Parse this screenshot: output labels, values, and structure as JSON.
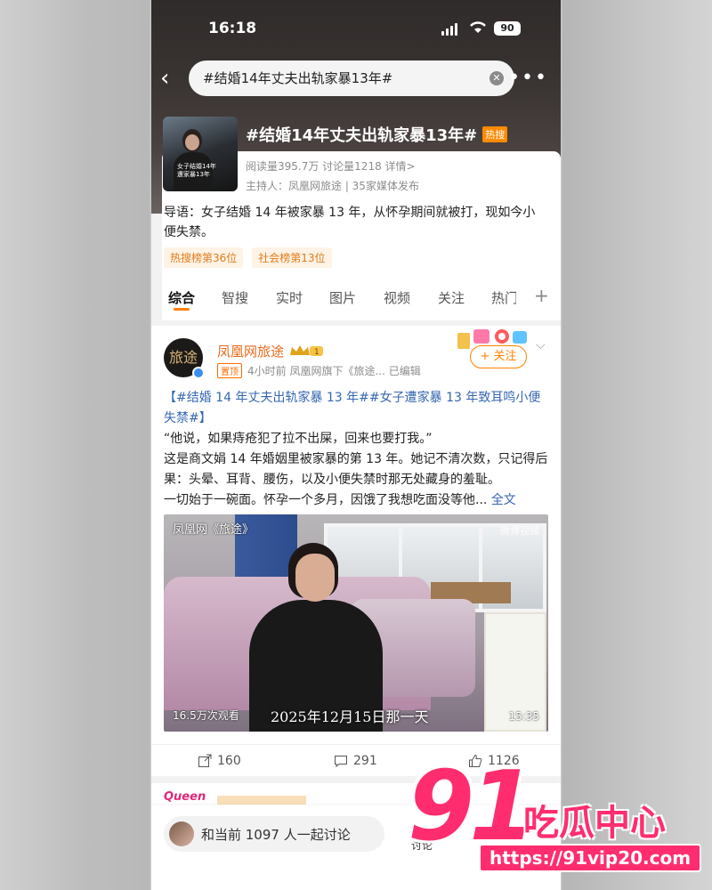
{
  "status_bar": {
    "time": "16:18",
    "battery": "90"
  },
  "search": {
    "query": "#结婚14年丈夫出轨家暴13年#"
  },
  "topic": {
    "title": "#结婚14年丈夫出轨家暴13年#",
    "hot_badge": "热搜",
    "thumb_caption": "女子结婚14年\n遭家暴13年",
    "stats": "阅读量395.7万  讨论量1218  详情>",
    "host": "主持人：凤凰网旅途 | 35家媒体发布",
    "intro": "导语：女子结婚 14 年被家暴 13 年，从怀孕期间就被打，现如今小便失禁。",
    "tags": [
      "热搜榜第36位",
      "社会榜第13位"
    ]
  },
  "tabs": [
    "综合",
    "智搜",
    "实时",
    "图片",
    "视频",
    "关注",
    "热门"
  ],
  "post": {
    "avatar_text": "旅途",
    "username": "凤凰网旅途",
    "pin_label": "置顶",
    "meta": "4小时前  凤凰网旗下《旅途...  已编辑",
    "follow_label": "+ 关注",
    "hashtag_line": "【#结婚 14 年丈夫出轨家暴 13 年##女子遭家暴 13 年致耳鸣小便失禁#】",
    "lines": [
      "“他说，如果痔疮犯了拉不出屎，回来也要打我。”",
      "这是商文娟 14 年婚姻里被家暴的第 13 年。她记不清次数，只记得后果：头晕、耳背、腰伤，以及小便失禁时那无处藏身的羞耻。",
      "一切始于一碗面。怀孕一个多月，因饿了我想吃面没等他..."
    ],
    "more_link": "全文",
    "video": {
      "watermark_left": "凤凰网《旅途》",
      "watermark_right": "微博视频",
      "views": "16.5万次观看",
      "caption": "2025年12月15日那一天",
      "duration": "15:35"
    },
    "actions": {
      "reposts": "160",
      "comments": "291",
      "likes": "1126"
    }
  },
  "next_post": {
    "avatar_text": "Queen"
  },
  "discuss": {
    "text": "和当前 1097 人一起讨论",
    "label": "讨论"
  },
  "overlay_logo": {
    "number": "91",
    "text": "吃瓜中心",
    "url": "https://91vip20.com"
  },
  "colors": {
    "accent": "#ff8200",
    "link": "#3566b0",
    "hot": "#ff8a00",
    "logo": "#ff2d6f"
  }
}
